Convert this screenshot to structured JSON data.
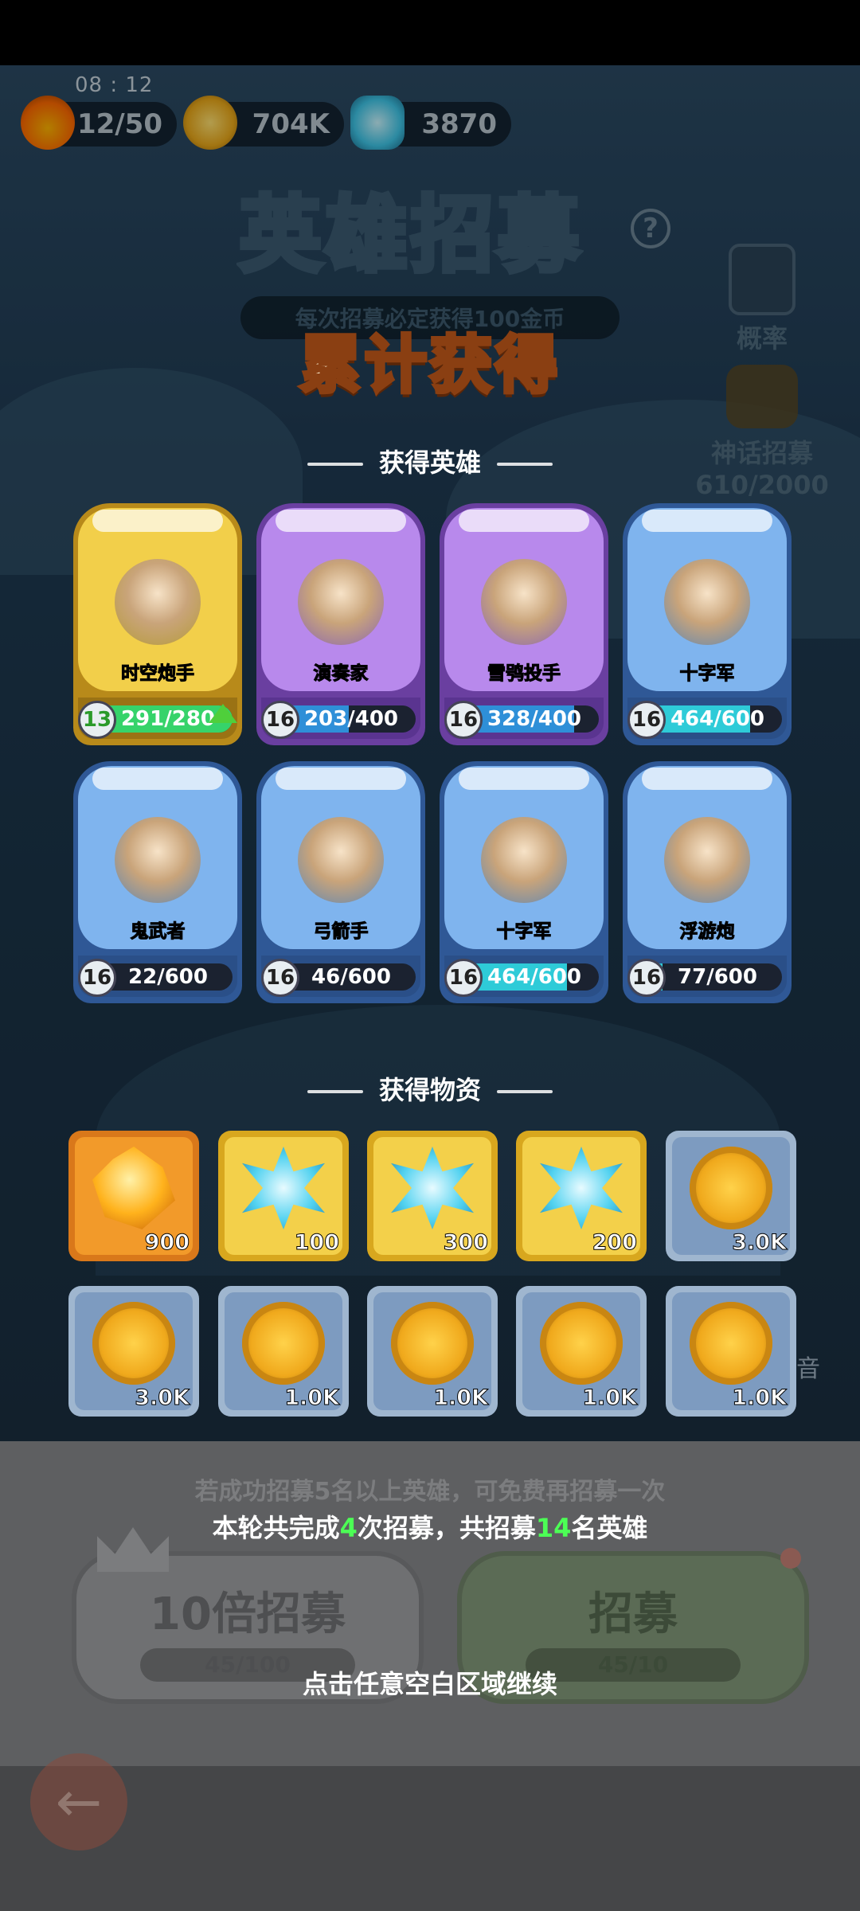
{
  "top_bar": {
    "time": "08 : 12",
    "energy": "12/50",
    "gold": "704K",
    "gems": "3870"
  },
  "page": {
    "title": "英雄招募",
    "subtitle": "每次招募必定获得100金币",
    "probability_label": "概率",
    "mythic_label": "神话招募",
    "mythic_progress": "610/2000"
  },
  "result": {
    "heading": "累计获得",
    "heroes_section": "获得英雄",
    "items_section": "获得物资"
  },
  "heroes": [
    {
      "name": "时空炮手",
      "level": "13",
      "progress": "291/280",
      "ratio": 1.0,
      "frame": "gold",
      "can_upgrade": true
    },
    {
      "name": "演奏家",
      "level": "16",
      "progress": "203/400",
      "ratio": 0.51,
      "frame": "purple",
      "can_upgrade": false
    },
    {
      "name": "雪鸮投手",
      "level": "16",
      "progress": "328/400",
      "ratio": 0.82,
      "frame": "purple",
      "can_upgrade": false
    },
    {
      "name": "十字军",
      "level": "16",
      "progress": "464/600",
      "ratio": 0.77,
      "frame": "blue",
      "can_upgrade": false
    },
    {
      "name": "鬼武者",
      "level": "16",
      "progress": "22/600",
      "ratio": 0.04,
      "frame": "blue",
      "can_upgrade": false
    },
    {
      "name": "弓箭手",
      "level": "16",
      "progress": "46/600",
      "ratio": 0.08,
      "frame": "blue",
      "can_upgrade": false
    },
    {
      "name": "十字军",
      "level": "16",
      "progress": "464/600",
      "ratio": 0.77,
      "frame": "blue",
      "can_upgrade": false
    },
    {
      "name": "浮游炮",
      "level": "16",
      "progress": "77/600",
      "ratio": 0.13,
      "frame": "blue",
      "can_upgrade": false
    }
  ],
  "items": [
    {
      "type": "orange-crystal",
      "qty": "900",
      "frame": "orange"
    },
    {
      "type": "blue-gem",
      "qty": "100",
      "frame": "gold"
    },
    {
      "type": "blue-gem",
      "qty": "300",
      "frame": "gold"
    },
    {
      "type": "blue-gem",
      "qty": "200",
      "frame": "gold"
    },
    {
      "type": "gold-coin",
      "qty": "3.0K",
      "frame": "blue"
    },
    {
      "type": "gold-coin",
      "qty": "3.0K",
      "frame": "blue"
    },
    {
      "type": "gold-coin",
      "qty": "1.0K",
      "frame": "blue"
    },
    {
      "type": "gold-coin",
      "qty": "1.0K",
      "frame": "blue"
    },
    {
      "type": "gold-coin",
      "qty": "1.0K",
      "frame": "blue"
    },
    {
      "type": "gold-coin",
      "qty": "1.0K",
      "frame": "blue"
    }
  ],
  "bottom": {
    "bonus_hint": "若成功招募5名以上英雄，可免费再招募一次",
    "summary_prefix": "本轮共完成",
    "summary_count": "4",
    "summary_mid": "次招募，共招募",
    "summary_heroes": "14",
    "summary_suffix": "名英雄",
    "ten_pull_label": "10倍招募",
    "ten_pull_cost": "45/100",
    "single_pull_label": "招募",
    "single_pull_cost": "45/10",
    "continue_hint": "点击任意空白区域继续",
    "side_fragment": "音"
  },
  "colors": {
    "frame_gold": "#e8c13a",
    "frame_purple": "#a77be0",
    "frame_blue": "#6fa8e8",
    "progress_green": "#36d36a",
    "progress_cyan": "#2ecbd8",
    "highlight": "#4cff55"
  }
}
